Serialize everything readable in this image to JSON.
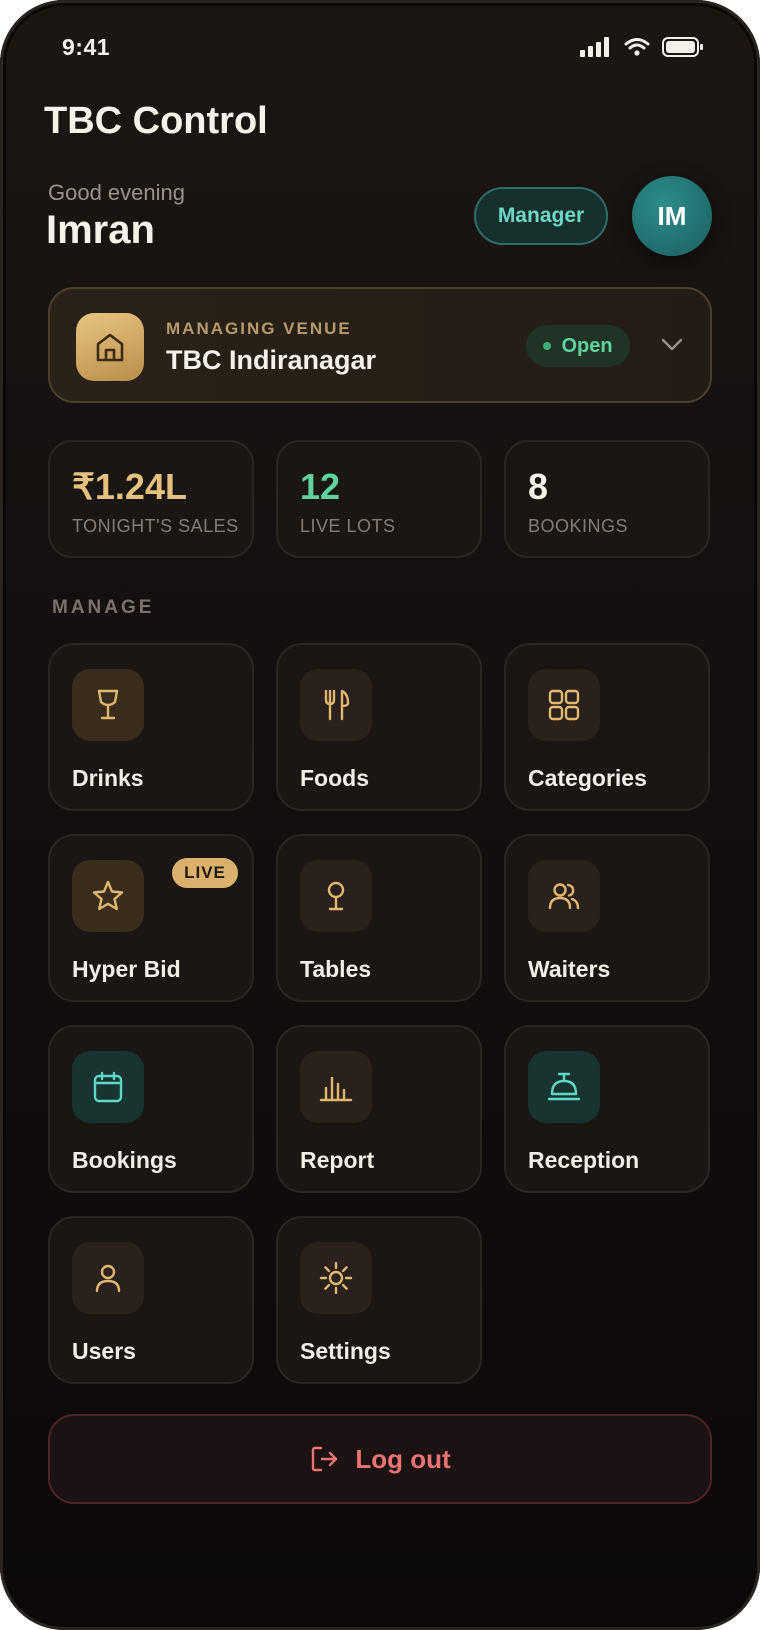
{
  "status_bar": {
    "time": "9:41",
    "icons": [
      "signal-icon",
      "wifi-icon",
      "battery-icon"
    ]
  },
  "app": {
    "title": "TBC Control"
  },
  "user": {
    "greeting": "Good evening",
    "name": "Imran",
    "role": "Manager",
    "initials": "IM"
  },
  "venue": {
    "kicker": "MANAGING VENUE",
    "name": "TBC Indiranagar",
    "status": "Open",
    "icon": "store-icon"
  },
  "stats": [
    {
      "value": "₹1.24L",
      "label": "TONIGHT'S SALES",
      "color": "#e6c07e"
    },
    {
      "value": "12",
      "label": "LIVE LOTS",
      "color": "#5fd39b"
    },
    {
      "value": "8",
      "label": "BOOKINGS",
      "color": "#f6f1ea"
    }
  ],
  "manage": {
    "title": "MANAGE",
    "tiles": [
      {
        "label": "Drinks",
        "icon": "wine-glass-icon"
      },
      {
        "label": "Foods",
        "icon": "utensils-icon"
      },
      {
        "label": "Categories",
        "icon": "grid-icon"
      },
      {
        "label": "Hyper Bid",
        "icon": "star-icon",
        "badge": "LIVE"
      },
      {
        "label": "Tables",
        "icon": "table-icon"
      },
      {
        "label": "Waiters",
        "icon": "people-icon"
      },
      {
        "label": "Bookings",
        "icon": "calendar-icon"
      },
      {
        "label": "Report",
        "icon": "bar-chart-icon"
      },
      {
        "label": "Reception",
        "icon": "bell-icon"
      },
      {
        "label": "Users",
        "icon": "user-icon"
      },
      {
        "label": "Settings",
        "icon": "sun-gear-icon"
      }
    ]
  },
  "logout": {
    "label": "Log out",
    "icon": "logout-icon"
  },
  "colors": {
    "gold": "#d9b06c",
    "teal": "#5fd6c6",
    "green": "#5fd39b",
    "red": "#e87373"
  }
}
